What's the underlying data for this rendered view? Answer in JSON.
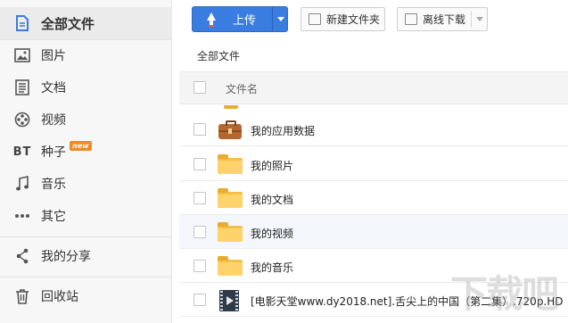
{
  "sidebar": {
    "items": [
      {
        "label": "全部文件",
        "icon": "file-icon",
        "active": true
      },
      {
        "label": "图片",
        "icon": "image-icon"
      },
      {
        "label": "文档",
        "icon": "document-icon"
      },
      {
        "label": "视频",
        "icon": "film-reel-icon"
      },
      {
        "label": "种子",
        "icon": "bt-icon",
        "icon_text": "BT",
        "badge": "new"
      },
      {
        "label": "音乐",
        "icon": "music-note-icon"
      },
      {
        "label": "其它",
        "icon": "more-dots-icon"
      },
      {
        "label": "我的分享",
        "icon": "share-icon"
      },
      {
        "label": "回收站",
        "icon": "trash-icon"
      }
    ]
  },
  "toolbar": {
    "upload_label": "上传",
    "new_folder_label": "新建文件夹",
    "offline_download_label": "离线下载"
  },
  "breadcrumb": "全部文件",
  "table": {
    "header_name": "文件名",
    "rows": [
      {
        "name": "我的应用数据",
        "icon": "briefcase-icon"
      },
      {
        "name": "我的照片",
        "icon": "folder-icon"
      },
      {
        "name": "我的文档",
        "icon": "folder-icon"
      },
      {
        "name": "我的视频",
        "icon": "folder-icon",
        "hover": true
      },
      {
        "name": "我的音乐",
        "icon": "folder-icon"
      },
      {
        "name": "[电影天堂www.dy2018.net].舌尖上的中国（第二集）.720p.HD",
        "icon": "video-file-icon"
      }
    ]
  },
  "colors": {
    "accent": "#3a7de0",
    "folder": "#f5c04a",
    "badge": "#f08a24"
  }
}
